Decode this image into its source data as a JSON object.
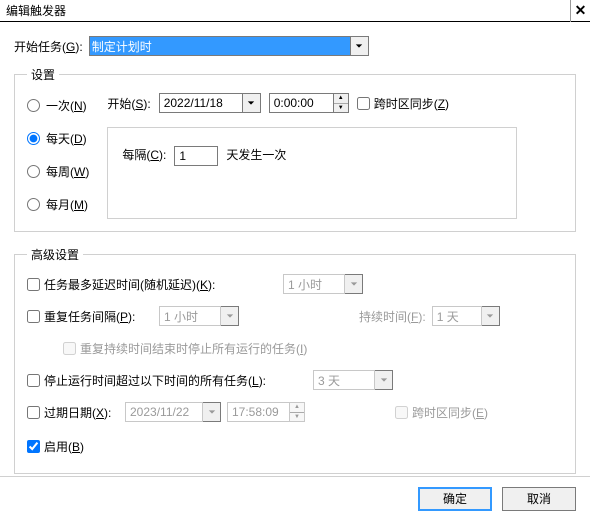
{
  "window": {
    "title": "编辑触发器"
  },
  "begin": {
    "label_pre": "开始任务(",
    "label_u": "G",
    "label_post": "):",
    "value": "制定计划时"
  },
  "settings": {
    "legend": "设置",
    "radios": {
      "once_pre": "一次(",
      "once_u": "N",
      "once_post": ")",
      "daily_pre": "每天(",
      "daily_u": "D",
      "daily_post": ")",
      "weekly_pre": "每周(",
      "weekly_u": "W",
      "weekly_post": ")",
      "monthly_pre": "每月(",
      "monthly_u": "M",
      "monthly_post": ")"
    },
    "start_label_pre": "开始(",
    "start_label_u": "S",
    "start_label_post": "):",
    "start_date": "2022/11/18",
    "start_time": "0:00:00",
    "sync_pre": "跨时区同步(",
    "sync_u": "Z",
    "sync_post": ")",
    "recur_label_pre": "每隔(",
    "recur_label_u": "C",
    "recur_label_post": "):",
    "recur_value": "1",
    "recur_suffix": "天发生一次"
  },
  "advanced": {
    "legend": "高级设置",
    "delay_pre": "任务最多延迟时间(随机延迟)(",
    "delay_u": "K",
    "delay_post": "):",
    "delay_value": "1 小时",
    "repeat_pre": "重复任务间隔(",
    "repeat_u": "P",
    "repeat_post": "):",
    "repeat_value": "1 小时",
    "duration_pre": "持续时间(",
    "duration_u": "F",
    "duration_post": "):",
    "duration_value": "1 天",
    "stop_at_end_pre": "重复持续时间结束时停止所有运行的任务(",
    "stop_at_end_u": "I",
    "stop_at_end_post": ")",
    "stop_task_pre": "停止运行时间超过以下时间的所有任务(",
    "stop_task_u": "L",
    "stop_task_post": "):",
    "stop_task_value": "3 天",
    "expire_pre": "过期日期(",
    "expire_u": "X",
    "expire_post": "):",
    "expire_date": "2023/11/22",
    "expire_time": "17:58:09",
    "expire_sync_pre": "跨时区同步(",
    "expire_sync_u": "E",
    "expire_sync_post": ")",
    "enabled_pre": "启用(",
    "enabled_u": "B",
    "enabled_post": ")"
  },
  "buttons": {
    "ok": "确定",
    "cancel": "取消"
  }
}
